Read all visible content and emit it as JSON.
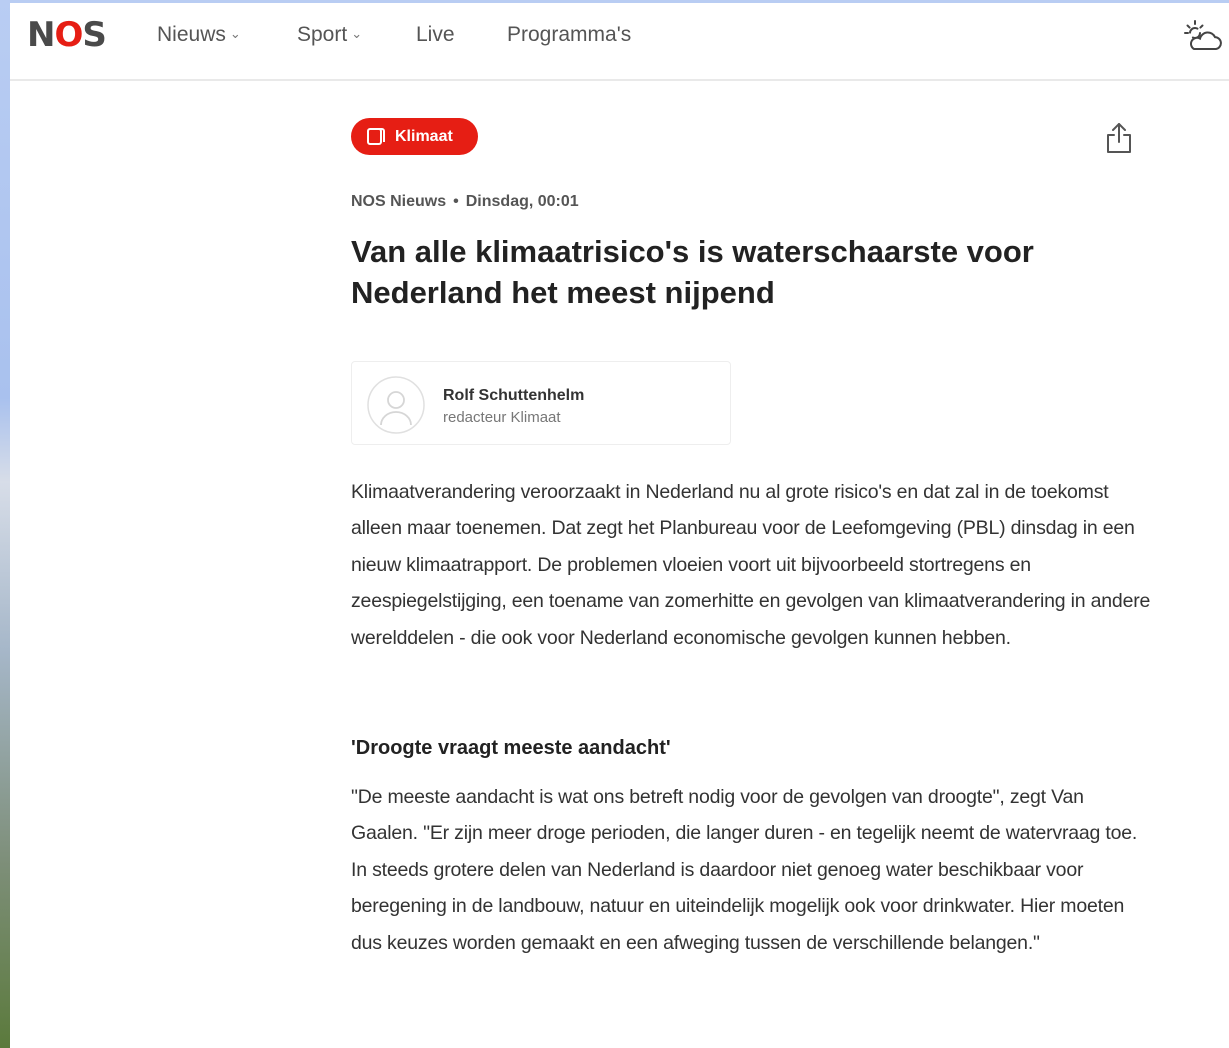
{
  "header": {
    "logo": {
      "part1": "N",
      "part2": "O",
      "part3": "S"
    },
    "nav": [
      {
        "label": "Nieuws",
        "has_dropdown": true
      },
      {
        "label": "Sport",
        "has_dropdown": true
      },
      {
        "label": "Live",
        "has_dropdown": false
      },
      {
        "label": "Programma's",
        "has_dropdown": false
      }
    ],
    "chevron_glyph": "⌄",
    "weather_icon": "partly-cloudy-icon"
  },
  "article": {
    "category": "Klimaat",
    "category_icon": "bookmark-icon",
    "share_icon": "share-icon",
    "source": "NOS Nieuws",
    "separator": "•",
    "date": "Dinsdag, 00:01",
    "title": "Van alle klimaatrisico's is waterschaarste voor Nederland het meest nijpend",
    "author": {
      "name": "Rolf Schuttenhelm",
      "role": "redacteur Klimaat",
      "avatar_icon": "user-avatar-icon"
    },
    "paragraph1": "Klimaatverandering veroorzaakt in Nederland nu al grote risico's en dat zal in de toekomst alleen maar toenemen. Dat zegt het Planbureau voor de Leefomgeving (PBL) dinsdag in een nieuw klimaatrapport. De problemen vloeien voort uit bijvoorbeeld stortregens en zeespiegelstijging, een toename van zomerhitte en gevolgen van klimaatverandering in andere werelddelen - die ook voor Nederland economische gevolgen kunnen hebben.",
    "subheading": "'Droogte vraagt meeste aandacht'",
    "paragraph2": "\"De meeste aandacht is wat ons betreft nodig voor de gevolgen van droogte\", zegt Van Gaalen. \"Er zijn meer droge perioden, die langer duren - en tegelijk neemt de watervraag toe. In steeds grotere delen van Nederland is daardoor niet genoeg water beschikbaar voor beregening in de landbouw, natuur en uiteindelijk mogelijk ook voor drinkwater. Hier moeten dus keuzes worden gemaakt en een afweging tussen de verschillende belangen.\""
  },
  "colors": {
    "brand_red": "#e61e14",
    "text_dark": "#222222",
    "text_body": "#333333",
    "text_muted": "#777777"
  }
}
